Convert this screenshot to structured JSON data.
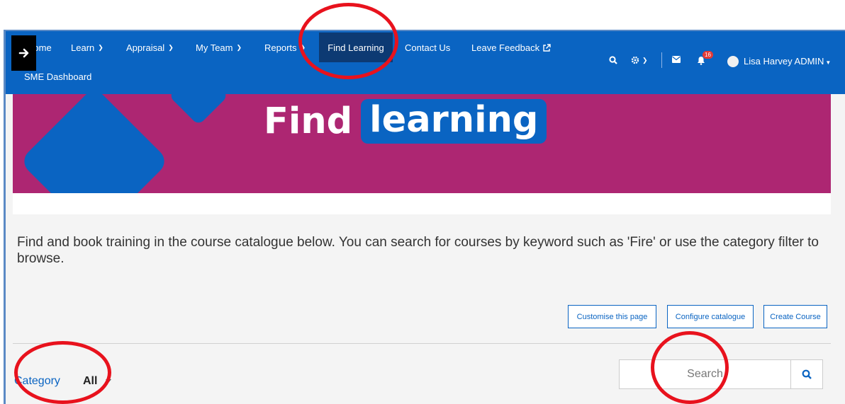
{
  "nav": {
    "home_label": "Home",
    "learn_label": "Learn",
    "appraisal_label": "Appraisal",
    "my_team_label": "My Team",
    "reports_label": "Reports",
    "find_learning_label": "Find Learning",
    "contact_label": "Contact Us",
    "feedback_label": "Leave Feedback",
    "sme_label": "SME Dashboard",
    "notification_count": "16",
    "user_name": "Lisa Harvey ADMIN"
  },
  "banner": {
    "title_part1": "Find",
    "title_part2": "learning"
  },
  "intro_text": "Find and book training in the course catalogue below.  You can search for courses by keyword such as 'Fire' or use the category filter to browse.",
  "actions": {
    "customise_label": "Customise this page",
    "configure_label": "Configure catalogue",
    "create_label": "Create Course"
  },
  "filter": {
    "category_label": "Category",
    "category_value": "All"
  },
  "search": {
    "placeholder": "Search"
  },
  "colors": {
    "nav_blue": "#0a64c2",
    "nav_active": "#0d3a73",
    "banner_magenta": "#ad2672",
    "annotation_red": "#e8121d"
  }
}
